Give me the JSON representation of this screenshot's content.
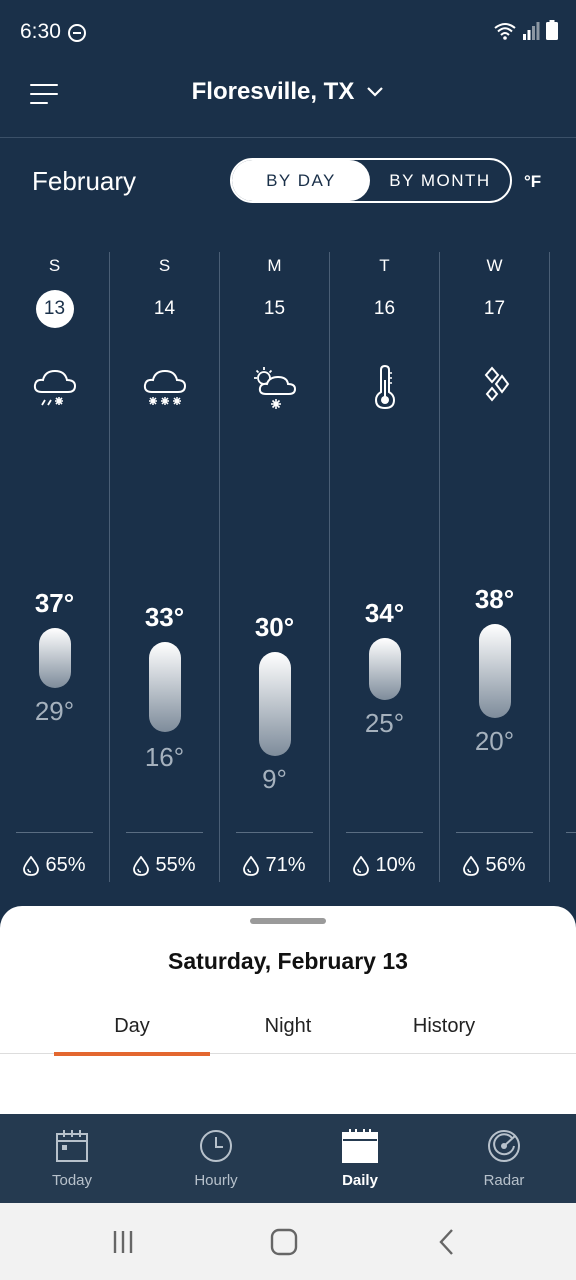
{
  "status": {
    "time": "6:30"
  },
  "header": {
    "location": "Floresville, TX"
  },
  "month": "February",
  "toggle": {
    "by_day": "BY DAY",
    "by_month": "BY MONTH"
  },
  "unit": "°F",
  "days": [
    {
      "letter": "S",
      "date": "13",
      "icon": "snow-sleet-cloud-icon",
      "hi": "37°",
      "lo": "29°",
      "precip": "65%"
    },
    {
      "letter": "S",
      "date": "14",
      "icon": "heavy-snow-cloud-icon",
      "hi": "33°",
      "lo": "16°",
      "precip": "55%"
    },
    {
      "letter": "M",
      "date": "15",
      "icon": "partly-sunny-snow-icon",
      "hi": "30°",
      "lo": "9°",
      "precip": "71%"
    },
    {
      "letter": "T",
      "date": "16",
      "icon": "thermometer-cold-icon",
      "hi": "34°",
      "lo": "25°",
      "precip": "10%"
    },
    {
      "letter": "W",
      "date": "17",
      "icon": "ice-crystals-icon",
      "hi": "38°",
      "lo": "20°",
      "precip": "56%"
    }
  ],
  "sheet": {
    "title": "Saturday, February 13",
    "tabs": [
      "Day",
      "Night",
      "History"
    ]
  },
  "nav": [
    "Today",
    "Hourly",
    "Daily",
    "Radar"
  ],
  "colors": {
    "background": "#1a3049",
    "accent": "#e3672f",
    "nav_background": "#253a50"
  }
}
